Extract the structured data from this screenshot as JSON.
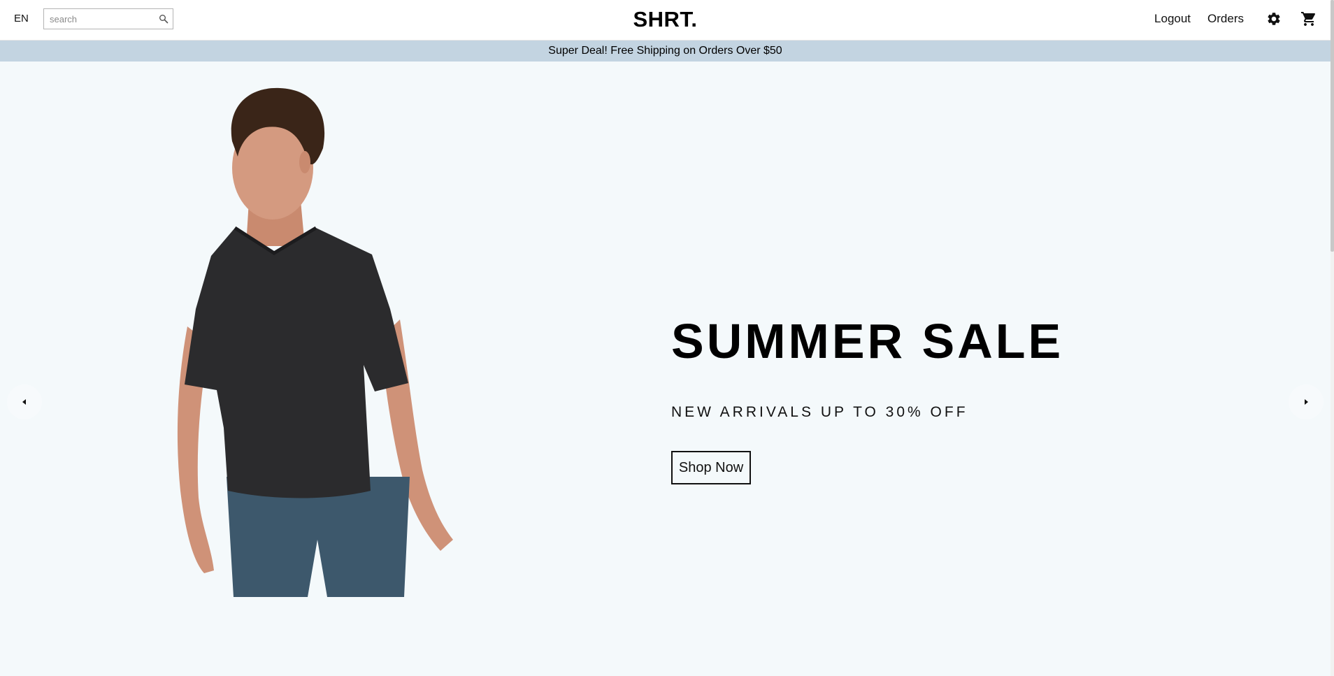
{
  "navbar": {
    "language": "EN",
    "search_placeholder": "search",
    "search_value": "",
    "logo": "SHRT.",
    "links": {
      "logout": "Logout",
      "orders": "Orders"
    },
    "icons": {
      "search": "search-icon",
      "settings": "gear-icon",
      "cart": "cart-icon"
    }
  },
  "announcement": "Super Deal! Free Shipping on Orders Over $50",
  "hero": {
    "title": "SUMMER SALE",
    "subtitle": "NEW ARRIVALS UP TO 30% OFF",
    "cta": "Shop Now",
    "background": "#f4f9fb",
    "image": "man-in-dark-tshirt"
  },
  "carousel": {
    "prev_icon": "arrow-left-icon",
    "next_icon": "arrow-right-icon"
  },
  "colors": {
    "announcement_bg": "#c3d4e1",
    "text": "#000000",
    "hero_bg": "#f4f9fb"
  }
}
